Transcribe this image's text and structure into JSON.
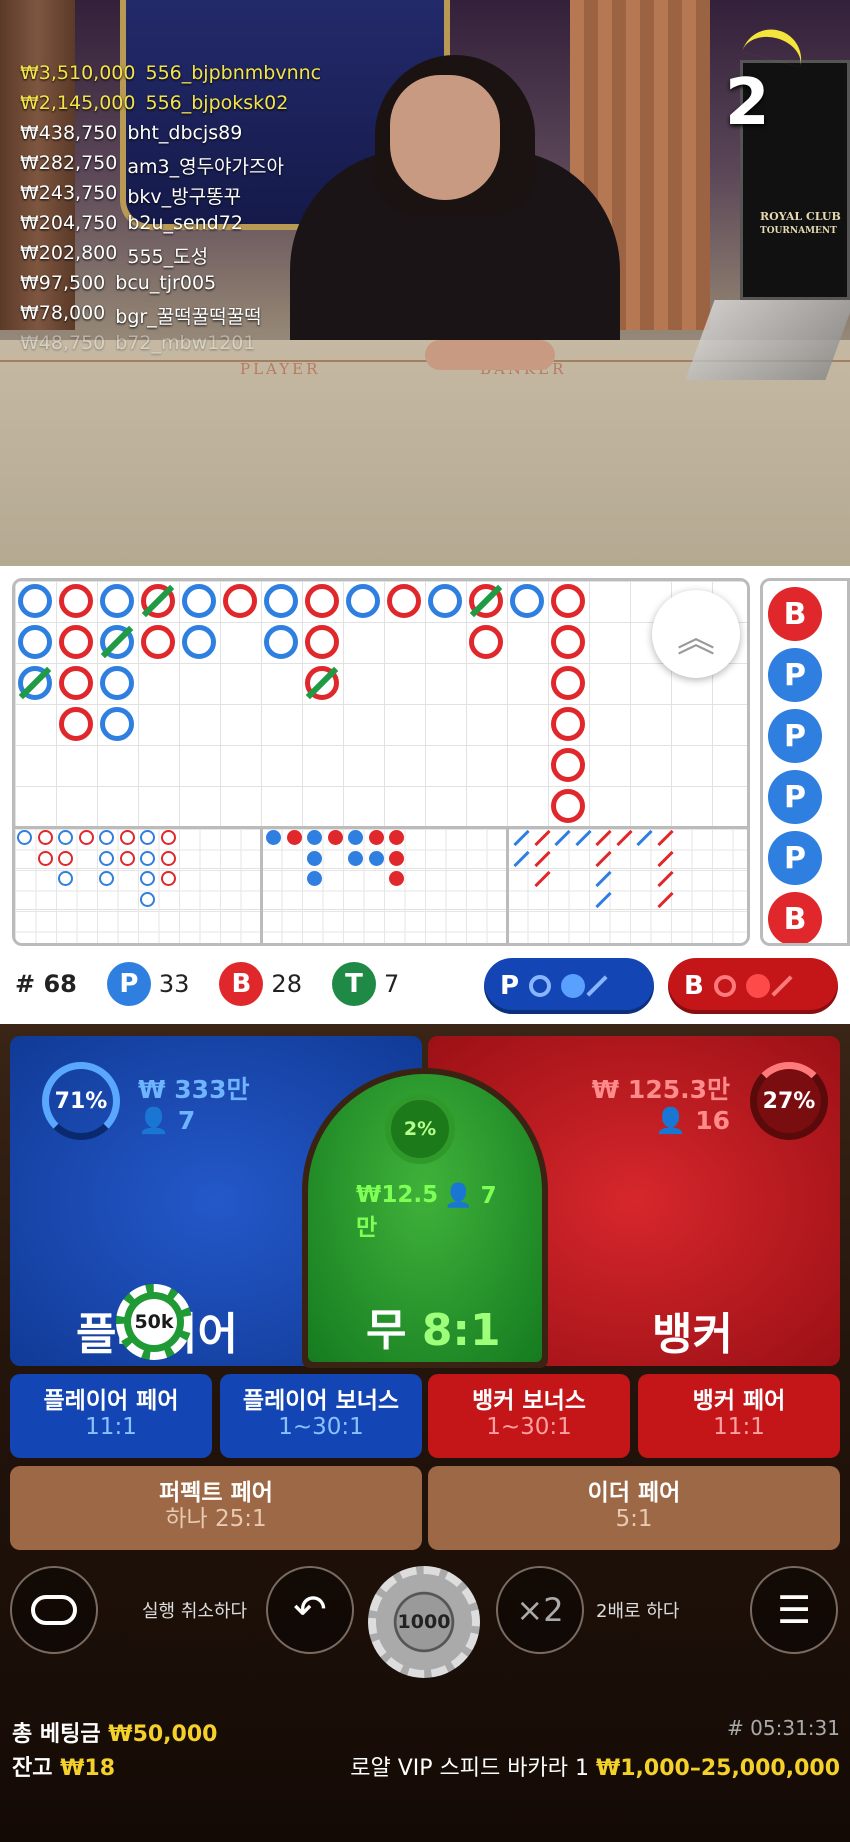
{
  "stream": {
    "countdown": "2",
    "bets": [
      {
        "amount": "₩3,510,000",
        "user": "556_bjpbnmbvnnc",
        "highlight": true
      },
      {
        "amount": "₩2,145,000",
        "user": "556_bjpoksk02",
        "highlight": true
      },
      {
        "amount": "₩438,750",
        "user": "bht_dbcjs89",
        "highlight": false
      },
      {
        "amount": "₩282,750",
        "user": "am3_영두야가즈아",
        "highlight": false
      },
      {
        "amount": "₩243,750",
        "user": "bkv_방구똥꾸",
        "highlight": false
      },
      {
        "amount": "₩204,750",
        "user": "b2u_send72",
        "highlight": false
      },
      {
        "amount": "₩202,800",
        "user": "555_도성",
        "highlight": false
      },
      {
        "amount": "₩97,500",
        "user": "bcu_tjr005",
        "highlight": false
      },
      {
        "amount": "₩78,000",
        "user": "bgr_꿀떡꿀떡꿀떡",
        "highlight": false
      },
      {
        "amount": "₩48,750",
        "user": "b72_mbw1201",
        "highlight": false
      }
    ],
    "table_labels": {
      "player": "PLAYER",
      "banker": "BANKER",
      "brand": "ROYAL CLUB",
      "brand_sub": "TOURNAMENT"
    }
  },
  "roads": {
    "bead_letters": [
      "B",
      "P",
      "P",
      "P",
      "P",
      "B"
    ]
  },
  "stats": {
    "total_label": "# 68",
    "player_letter": "P",
    "player_count": "33",
    "banker_letter": "B",
    "banker_count": "28",
    "tie_letter": "T",
    "tie_count": "7",
    "predict_player": "P",
    "predict_banker": "B"
  },
  "bets": {
    "player": {
      "percent": "71%",
      "amount": "₩ 333만",
      "players": "7",
      "label": "플레이어"
    },
    "tie": {
      "percent": "2%",
      "amount": "₩12.5만",
      "players": "7",
      "label": "무",
      "odds": "8:1"
    },
    "banker": {
      "percent": "27%",
      "amount": "₩ 125.3만",
      "players": "16",
      "label": "뱅커"
    },
    "placed_chip": "50k",
    "side": [
      {
        "label": "플레이어 페어",
        "odds": "11:1"
      },
      {
        "label": "플레이어 보너스",
        "odds": "1~30:1"
      },
      {
        "label": "뱅커 보너스",
        "odds": "1~30:1"
      },
      {
        "label": "뱅커 페어",
        "odds": "11:1"
      }
    ],
    "perfect_pair": {
      "label": "퍼펙트 페어",
      "odds": "하나 25:1"
    },
    "either_pair": {
      "label": "이더 페어",
      "odds": "5:1"
    }
  },
  "controls": {
    "undo_label": "실행 취소하다",
    "chip_value": "1000",
    "double_icon": "×2",
    "double_label": "2배로 하다"
  },
  "footer": {
    "total_bet_label": "총 베팅금",
    "total_bet_value": "₩50,000",
    "balance_label": "잔고",
    "balance_value": "₩18",
    "round_id": "# 05:31:31",
    "table_name": "로얄 VIP 스피드 바카라 1",
    "limits": "₩1,000–25,000,000"
  },
  "colors": {
    "player": "#2f7fe0",
    "banker": "#e0272b",
    "tie": "#1f9a45",
    "gold": "#f4d12a"
  }
}
